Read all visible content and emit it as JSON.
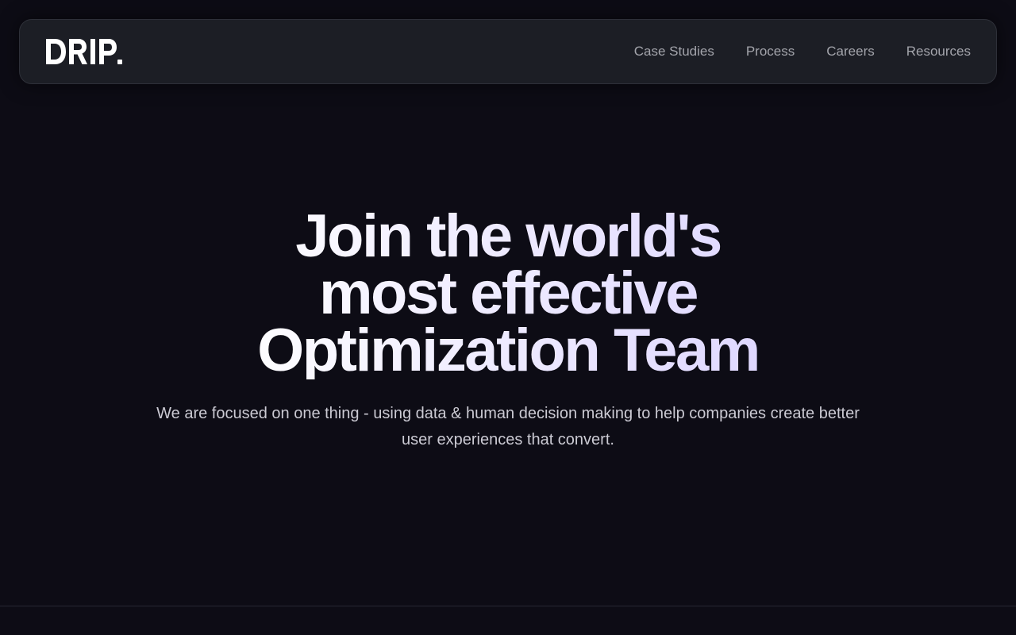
{
  "brand": {
    "logo_text": "DRIP.",
    "logo_color": "#ffffff"
  },
  "nav": {
    "items": [
      {
        "label": "Case Studies"
      },
      {
        "label": "Process"
      },
      {
        "label": "Careers"
      },
      {
        "label": "Resources"
      }
    ]
  },
  "hero": {
    "title_line_1": "Join the world's",
    "title_line_2": "most effective",
    "title_line_3": "Optimization Team",
    "subtitle": "We are focused on one thing - using data & human decision making to help companies create better user experiences that convert."
  },
  "colors": {
    "background": "#0d0c15",
    "navbar_background": "#1c1e25",
    "nav_text": "#a3a4ab",
    "title_gradient_start": "#ffffff",
    "title_gradient_end": "#ddd6ff",
    "subtitle_text": "#cbcad3"
  }
}
